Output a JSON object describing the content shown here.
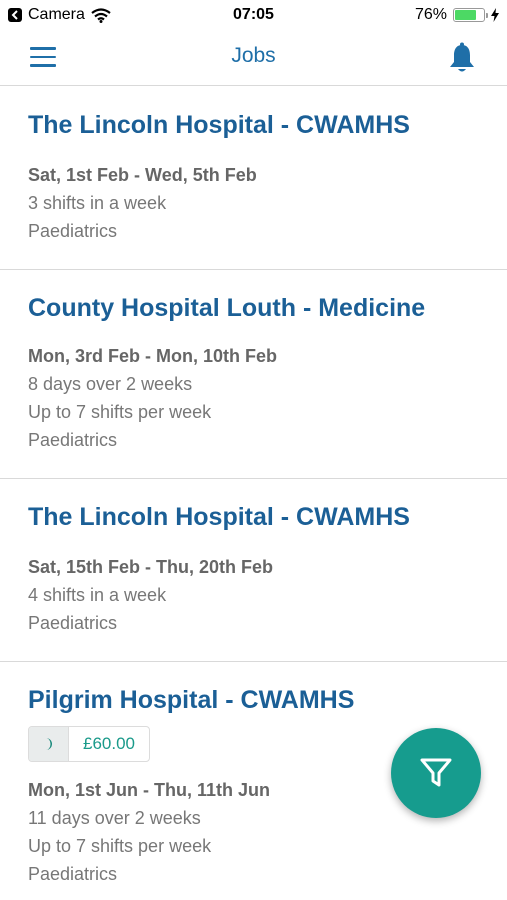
{
  "status_bar": {
    "back_app": "Camera",
    "time": "07:05",
    "battery_percent": "76%",
    "battery_level": 0.76
  },
  "nav": {
    "title": "Jobs",
    "menu_icon": "hamburger-menu-icon",
    "bell_icon": "bell-icon"
  },
  "jobs": [
    {
      "title": "The Lincoln Hospital - CWAMHS",
      "dates": "Sat, 1st Feb - Wed, 5th Feb",
      "lines": [
        "3 shifts in a week",
        "Paediatrics"
      ]
    },
    {
      "title": "County Hospital Louth - Medicine",
      "dates": "Mon, 3rd Feb - Mon, 10th Feb",
      "lines": [
        "8 days over 2 weeks",
        "Up to 7 shifts per week",
        "Paediatrics"
      ]
    },
    {
      "title": "The Lincoln Hospital - CWAMHS",
      "dates": "Sat, 15th Feb - Thu, 20th Feb",
      "lines": [
        "4 shifts in a week",
        "Paediatrics"
      ]
    },
    {
      "title": "Pilgrim Hospital - CWAMHS",
      "rate": "£60.00",
      "rate_icon": "moon-icon",
      "dates": "Mon, 1st Jun - Thu, 11th Jun",
      "lines": [
        "11 days over 2 weeks",
        "Up to 7 shifts per week",
        "Paediatrics"
      ]
    }
  ],
  "fab": {
    "icon": "filter-icon"
  },
  "colors": {
    "primary": "#1f6fa8",
    "title": "#1b5f96",
    "accent": "#169c8e",
    "battery": "#4cd964"
  }
}
